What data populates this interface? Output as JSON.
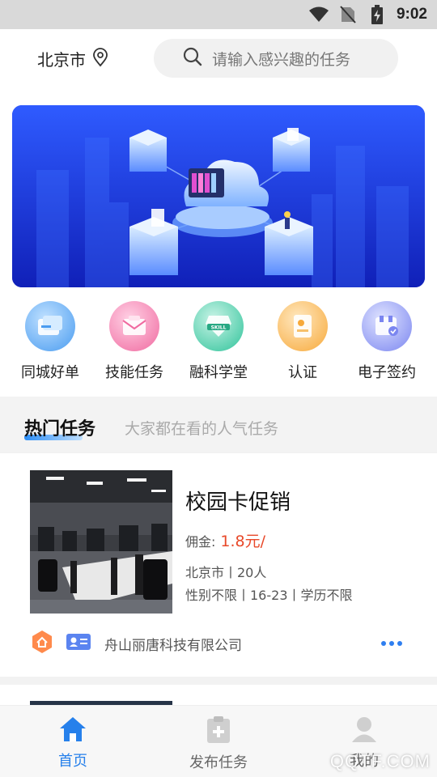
{
  "status_bar": {
    "time": "9:02",
    "icons": [
      "wifi-icon",
      "no-sim-icon",
      "battery-charging-icon"
    ]
  },
  "header": {
    "city": "北京市",
    "location_icon": "location-pin-icon",
    "search_placeholder": "请输入感兴趣的任务",
    "search_icon": "search-icon"
  },
  "quick_menu": [
    {
      "label": "同城好单",
      "icon": "city-orders-icon",
      "color": "#4a9cf0"
    },
    {
      "label": "技能任务",
      "icon": "skill-task-icon",
      "color": "#f06aa0"
    },
    {
      "label": "融科学堂",
      "icon": "skill-academy-icon",
      "color": "#2fc39a",
      "badge": "SKILL"
    },
    {
      "label": "认证",
      "icon": "certification-icon",
      "color": "#f7a93a"
    },
    {
      "label": "电子签约",
      "icon": "e-sign-icon",
      "color": "#7b86f0"
    }
  ],
  "hot_tasks": {
    "title": "热门任务",
    "subtitle": "大家都在看的人气任务"
  },
  "task": {
    "title": "校园卡促销",
    "commission_label": "佣金:",
    "commission_value": "1.8元/",
    "meta_location": "北京市丨20人",
    "meta_requirements": "性别不限丨16-23丨学历不限",
    "company": "舟山丽唐科技有限公司"
  },
  "bottom_nav": [
    {
      "label": "首页",
      "icon": "home-icon",
      "active": true
    },
    {
      "label": "发布任务",
      "icon": "publish-task-icon",
      "active": false
    },
    {
      "label": "我的",
      "icon": "profile-icon",
      "active": false
    }
  ],
  "watermark": "QQTF.COM",
  "colors": {
    "accent": "#2680eb",
    "commission": "#e8492a"
  }
}
